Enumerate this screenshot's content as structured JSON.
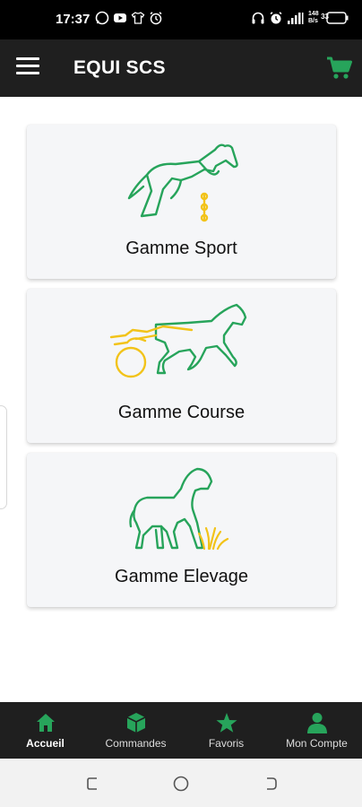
{
  "status_bar": {
    "time": "17:37",
    "left_icons": [
      "whatsapp-icon",
      "youtube-icon",
      "shirt-icon",
      "alarm-icon"
    ],
    "right_icons": [
      "headset-icon",
      "alarm-icon",
      "signal-icon",
      "wifi-speed-icon",
      "battery-icon"
    ],
    "network_speed": "148 B/s",
    "battery_level": "33"
  },
  "app_bar": {
    "title": "EQUI SCS",
    "menu_icon": "hamburger-menu-icon",
    "cart_icon": "shopping-cart-icon",
    "accent_color": "#27a45b"
  },
  "categories": [
    {
      "label": "Gamme Sport",
      "icon": "show-jumping-horse-icon"
    },
    {
      "label": "Gamme Course",
      "icon": "harness-racing-horse-icon"
    },
    {
      "label": "Gamme Elevage",
      "icon": "foal-grass-icon"
    }
  ],
  "bottom_nav": {
    "items": [
      {
        "label": "Accueil",
        "icon": "home-icon",
        "active": true
      },
      {
        "label": "Commandes",
        "icon": "package-icon",
        "active": false
      },
      {
        "label": "Favoris",
        "icon": "star-icon",
        "active": false
      },
      {
        "label": "Mon Compte",
        "icon": "user-icon",
        "active": false
      }
    ]
  },
  "colors": {
    "green": "#27a45b",
    "yellow": "#f2c319",
    "dark": "#1f1f1f"
  }
}
